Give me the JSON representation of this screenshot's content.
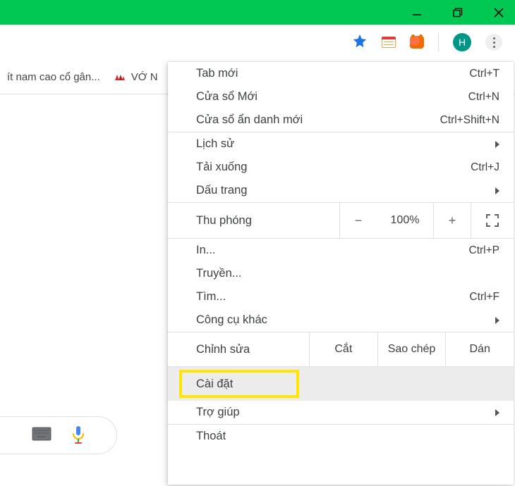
{
  "titlebar": {},
  "toolbar": {
    "avatar_initial": "H"
  },
  "bookmarks": {
    "item1": "ít nam cao cổ gân...",
    "item2": "VỚ N"
  },
  "menu": {
    "new_tab": {
      "label": "Tab mới",
      "shortcut": "Ctrl+T"
    },
    "new_window": {
      "label": "Cửa sổ Mới",
      "shortcut": "Ctrl+N"
    },
    "new_incognito": {
      "label": "Cửa sổ ẩn danh mới",
      "shortcut": "Ctrl+Shift+N"
    },
    "history": {
      "label": "Lịch sử"
    },
    "downloads": {
      "label": "Tải xuống",
      "shortcut": "Ctrl+J"
    },
    "bookmarks": {
      "label": "Dấu trang"
    },
    "zoom": {
      "label": "Thu phóng",
      "minus": "−",
      "value": "100%",
      "plus": "+"
    },
    "print": {
      "label": "In...",
      "shortcut": "Ctrl+P"
    },
    "cast": {
      "label": "Truyền..."
    },
    "find": {
      "label": "Tìm...",
      "shortcut": "Ctrl+F"
    },
    "more_tools": {
      "label": "Công cụ khác"
    },
    "edit": {
      "label": "Chỉnh sửa",
      "cut": "Cắt",
      "copy": "Sao chép",
      "paste": "Dán"
    },
    "settings": {
      "label": "Cài đặt"
    },
    "help": {
      "label": "Trợ giúp"
    },
    "exit": {
      "label": "Thoát"
    }
  }
}
